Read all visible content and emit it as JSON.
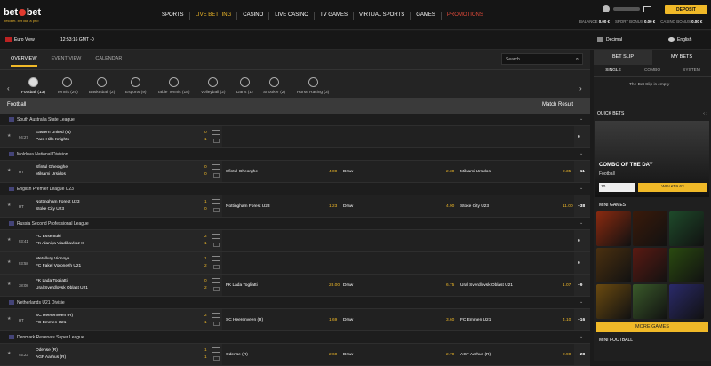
{
  "header": {
    "logo_a": "bet",
    "logo_b": "bet",
    "slogan": "betobet. bet like a pro!",
    "deposit": "DEPOSIT",
    "nav": [
      "SPORTS",
      "LIVE BETTING",
      "CASINO",
      "LIVE CASINO",
      "TV GAMES",
      "VIRTUAL SPORTS",
      "GAMES",
      "PROMOTIONS"
    ],
    "balance": [
      {
        "label": "BALANCE",
        "value": "0.00 €"
      },
      {
        "label": "SPORT BONUS",
        "value": "0.00 €"
      },
      {
        "label": "CASINO BONUS",
        "value": "0.00 €"
      }
    ]
  },
  "subbar": {
    "view": "Euro View",
    "time": "12:53:16 GMT -0",
    "odds_format": "Decimal",
    "language": "English"
  },
  "tabs": [
    "OVERVIEW",
    "EVENT VIEW",
    "CALENDAR"
  ],
  "search": {
    "placeholder": "Search"
  },
  "sports": [
    {
      "label": "Football (13)"
    },
    {
      "label": "Tennis (26)"
    },
    {
      "label": "Basketball (2)"
    },
    {
      "label": "Esports (9)"
    },
    {
      "label": "Table Tennis (18)"
    },
    {
      "label": "Volleyball (2)"
    },
    {
      "label": "Darts (1)"
    },
    {
      "label": "Snooker (2)"
    },
    {
      "label": "Horse Racing (3)"
    }
  ],
  "section": {
    "title": "Football",
    "market": "Match Result"
  },
  "leagues": [
    {
      "name": "South Australia State League",
      "events": [
        {
          "time": "94:27",
          "t1": "Eastern United (N)",
          "t2": "Para Hills Knights",
          "s1": "0",
          "s2": "1",
          "more": "0"
        }
      ]
    },
    {
      "name": "Moldova National Division",
      "events": [
        {
          "time": "HT",
          "t1": "Sfintul Gheorghe",
          "t2": "Milsami Ursidos",
          "s1": "0",
          "s2": "0",
          "h": "Sfintul Gheorghe",
          "ho": "4.00",
          "d": "Draw",
          "do": "2.30",
          "a": "Milsami Ursidos",
          "ao": "2.35",
          "more": "+11"
        }
      ]
    },
    {
      "name": "English Premier League U23",
      "events": [
        {
          "time": "HT",
          "t1": "Nottingham Forest U23",
          "t2": "Stoke City U23",
          "s1": "1",
          "s2": "0",
          "h": "Nottingham Forest U23",
          "ho": "1.23",
          "d": "Draw",
          "do": "4.90",
          "a": "Stoke City U23",
          "ao": "11.00",
          "more": "+38"
        }
      ]
    },
    {
      "name": "Russia Second Professional League",
      "events": [
        {
          "time": "93:41",
          "t1": "FC Essentuki",
          "t2": "FK Alaniya Vladikavkaz II",
          "s1": "2",
          "s2": "1",
          "more": "0"
        },
        {
          "time": "93:58",
          "t1": "Metallurg Vidnoye",
          "t2": "FC Fakel Voronezh U21",
          "s1": "1",
          "s2": "2",
          "more": "0"
        },
        {
          "time": "38:08",
          "t1": "FK Lada Togliatti",
          "t2": "Ural Sverdlovsk Oblast U21",
          "s1": "0",
          "s2": "2",
          "h": "FK Lada Togliatti",
          "ho": "28.00",
          "d": "Draw",
          "do": "6.75",
          "a": "Ural Sverdlovsk Oblast U21",
          "ao": "1.07",
          "more": "+9"
        }
      ]
    },
    {
      "name": "Netherlands U21 Divisie",
      "events": [
        {
          "time": "HT",
          "t1": "SC Heerenveen (R)",
          "t2": "FC Emmen U21",
          "s1": "2",
          "s2": "1",
          "h": "SC Heerenveen (R)",
          "ho": "1.69",
          "d": "Draw",
          "do": "3.60",
          "a": "FC Emmen U21",
          "ao": "4.10",
          "more": "+16"
        }
      ]
    },
    {
      "name": "Denmark Reserves Super League",
      "events": [
        {
          "time": "45:23",
          "t1": "Odense (R)",
          "t2": "AGF Aarhus (R)",
          "s1": "1",
          "s2": "1",
          "h": "Odense (R)",
          "ho": "2.60",
          "d": "Draw",
          "do": "2.70",
          "a": "AGF Aarhus (R)",
          "ao": "2.90",
          "more": "+28"
        }
      ]
    }
  ],
  "betslip": {
    "tabs": [
      "BET SLIP",
      "MY BETS"
    ],
    "types": [
      "SINGLE",
      "COMBO",
      "SYSTEM"
    ],
    "empty": "The Bet Slip is empty",
    "quick_bets": "QUICK BETS",
    "cod_title": "COMBO OF THE DAY",
    "cod_sport": "Football",
    "cod_stake": "10",
    "cod_win": "WIN €59.63",
    "mini_games": "MINI GAMES",
    "more_games": "MORE GAMES",
    "mini_football": "MINI FOOTBALL"
  },
  "tiles": [
    "#8a2a10",
    "#3a1a0a",
    "#1e4a2a",
    "#4a3010",
    "#5a1a12",
    "#2a4a10",
    "#6a4a10",
    "#3a5a2a",
    "#2a2a6a"
  ]
}
